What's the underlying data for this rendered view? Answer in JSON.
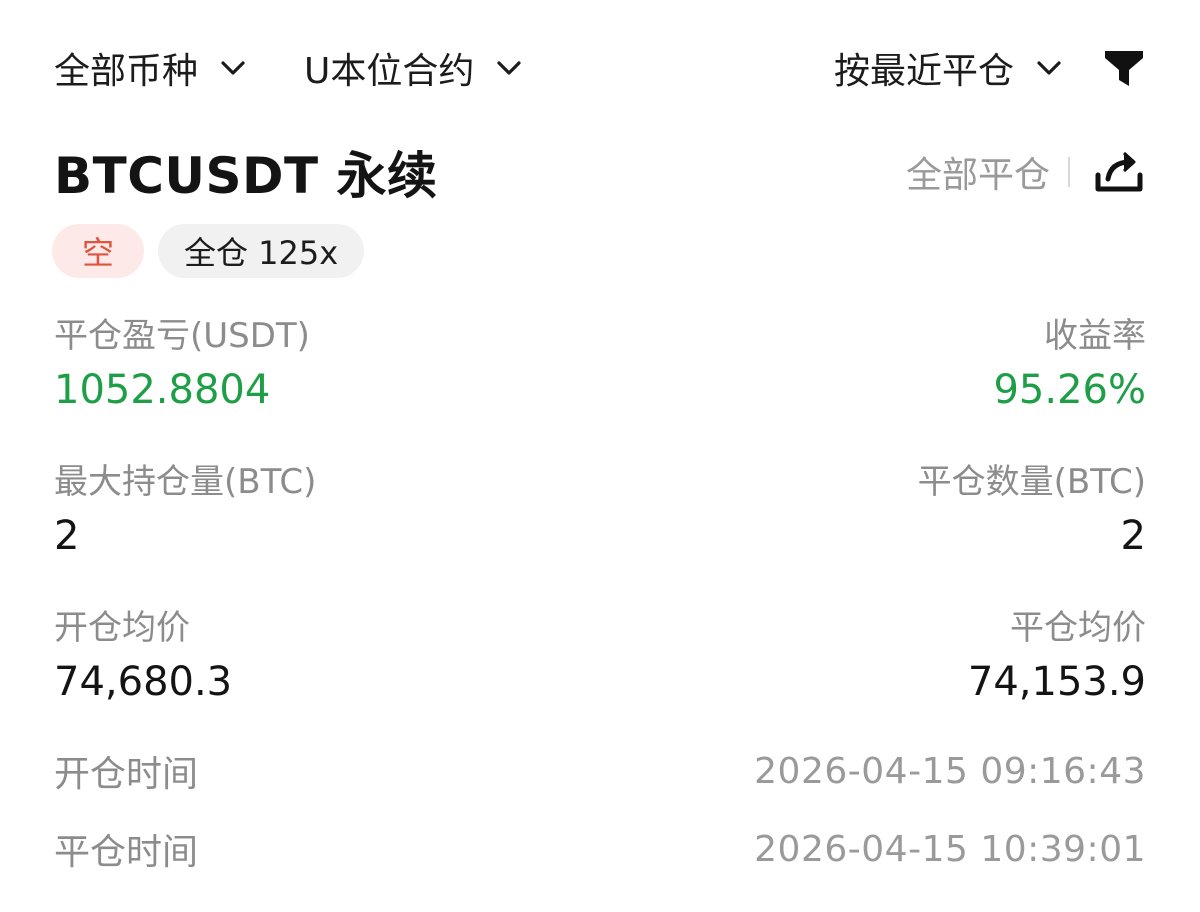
{
  "filters": {
    "coins_label": "全部币种",
    "contract_label": "U本位合约",
    "sort_label": "按最近平仓"
  },
  "position": {
    "symbol": "BTCUSDT 永续",
    "close_all_label": "全部平仓",
    "side_tag": "空",
    "margin_tag": "全仓 125x"
  },
  "stats": {
    "pnl_label": "平仓盈亏(USDT)",
    "pnl_value": "1052.8804",
    "roi_label": "收益率",
    "roi_value": "95.26%",
    "max_pos_label": "最大持仓量(BTC)",
    "max_pos_value": "2",
    "close_qty_label": "平仓数量(BTC)",
    "close_qty_value": "2",
    "open_avg_label": "开仓均价",
    "open_avg_value": "74,680.3",
    "close_avg_label": "平仓均价",
    "close_avg_value": "74,153.9",
    "open_time_label": "开仓时间",
    "open_time_value": "2026-04-15 09:16:43",
    "close_time_label": "平仓时间",
    "close_time_value": "2026-04-15 10:39:01"
  },
  "colors": {
    "profit_green": "#1e9e47",
    "short_red": "#e0533f",
    "short_bg": "#fdeae8",
    "muted_text": "#8c8c8c"
  },
  "icons": {
    "filter_dropdown": "chevron-down-icon",
    "filter_funnel": "funnel-icon",
    "share": "share-icon"
  }
}
